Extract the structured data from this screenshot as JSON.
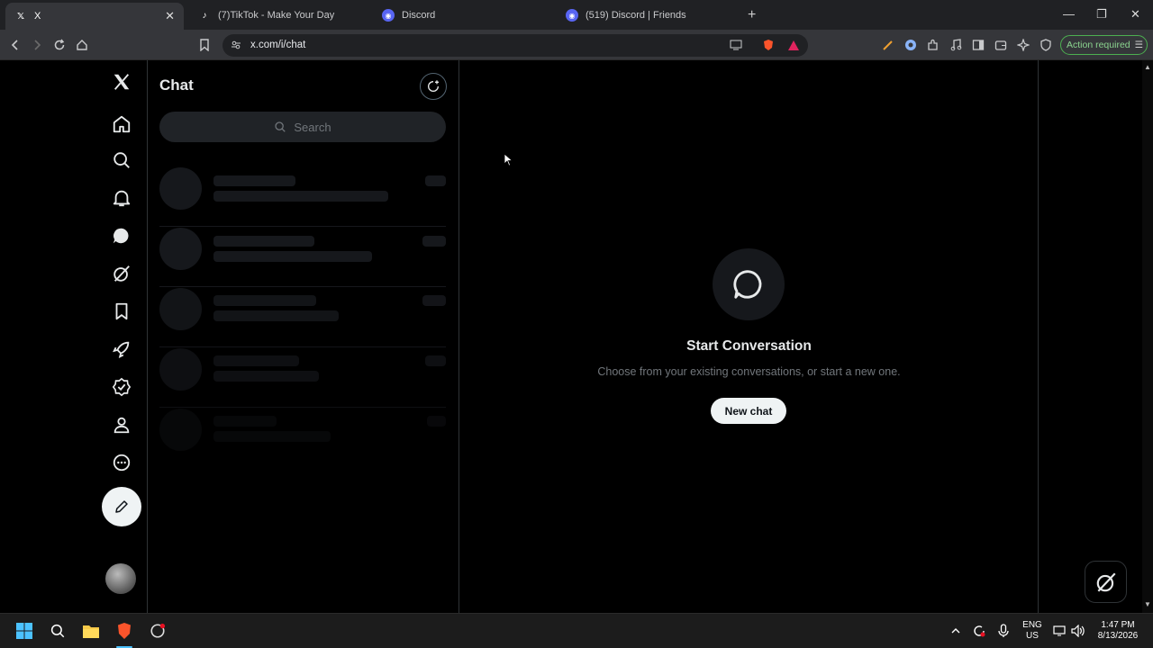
{
  "browser": {
    "tabs": [
      {
        "title": "X",
        "active": true
      },
      {
        "title": "(7)TikTok - Make Your Day"
      },
      {
        "title": "Discord"
      },
      {
        "title": "(519) Discord | Friends",
        "badge": "519"
      }
    ],
    "url": "x.com/i/chat",
    "action_required": "Action required"
  },
  "chat": {
    "title": "Chat",
    "search_placeholder": "Search"
  },
  "main": {
    "heading": "Start Conversation",
    "subtitle": "Choose from your existing conversations, or start a new one.",
    "new_chat_label": "New chat"
  },
  "taskbar": {
    "lang_top": "ENG",
    "lang_bottom": "US",
    "time": "1:47 PM",
    "date": "8/13/2026"
  },
  "colors": {
    "accent": "#eff3f4",
    "border": "#2f3336",
    "muted_text": "#71767b",
    "skeleton": "#16181c"
  }
}
